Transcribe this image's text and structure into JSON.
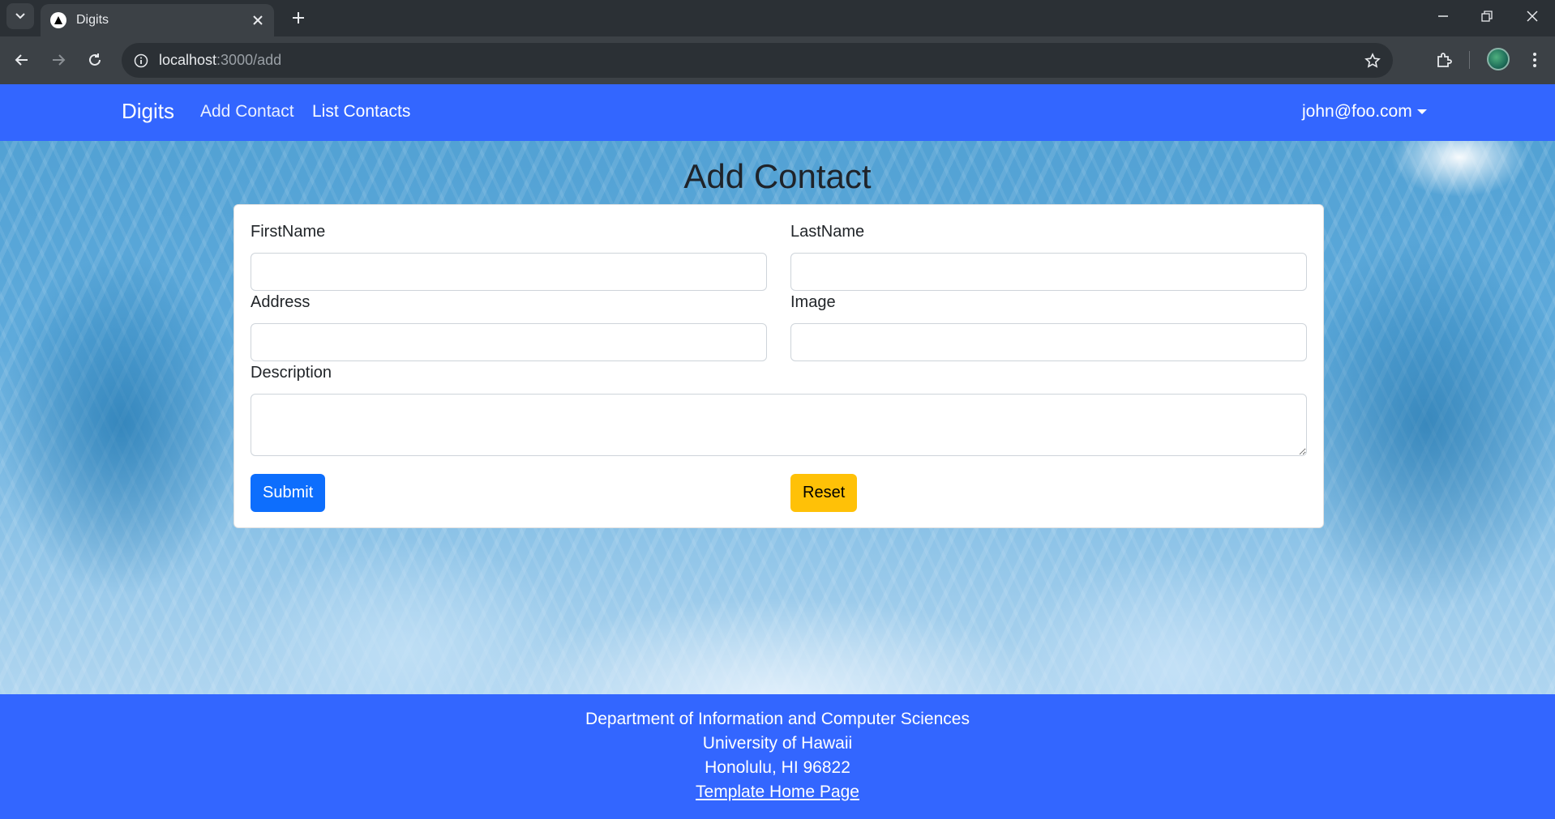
{
  "browser": {
    "tab_title": "Digits",
    "url_host": "localhost",
    "url_path": ":3000/add"
  },
  "navbar": {
    "brand": "Digits",
    "links": [
      "Add Contact",
      "List Contacts"
    ],
    "user": "john@foo.com"
  },
  "page": {
    "title": "Add Contact"
  },
  "form": {
    "first_name_label": "FirstName",
    "last_name_label": "LastName",
    "address_label": "Address",
    "image_label": "Image",
    "description_label": "Description",
    "first_name_value": "",
    "last_name_value": "",
    "address_value": "",
    "image_value": "",
    "description_value": "",
    "submit_label": "Submit",
    "reset_label": "Reset"
  },
  "footer": {
    "line1": "Department of Information and Computer Sciences",
    "line2": "University of Hawaii",
    "line3": "Honolulu, HI 96822",
    "link": "Template Home Page"
  },
  "colors": {
    "navbar_bg": "#3366ff",
    "footer_bg": "#3366ff",
    "submit_bg": "#0d6efd",
    "reset_bg": "#ffc107"
  }
}
